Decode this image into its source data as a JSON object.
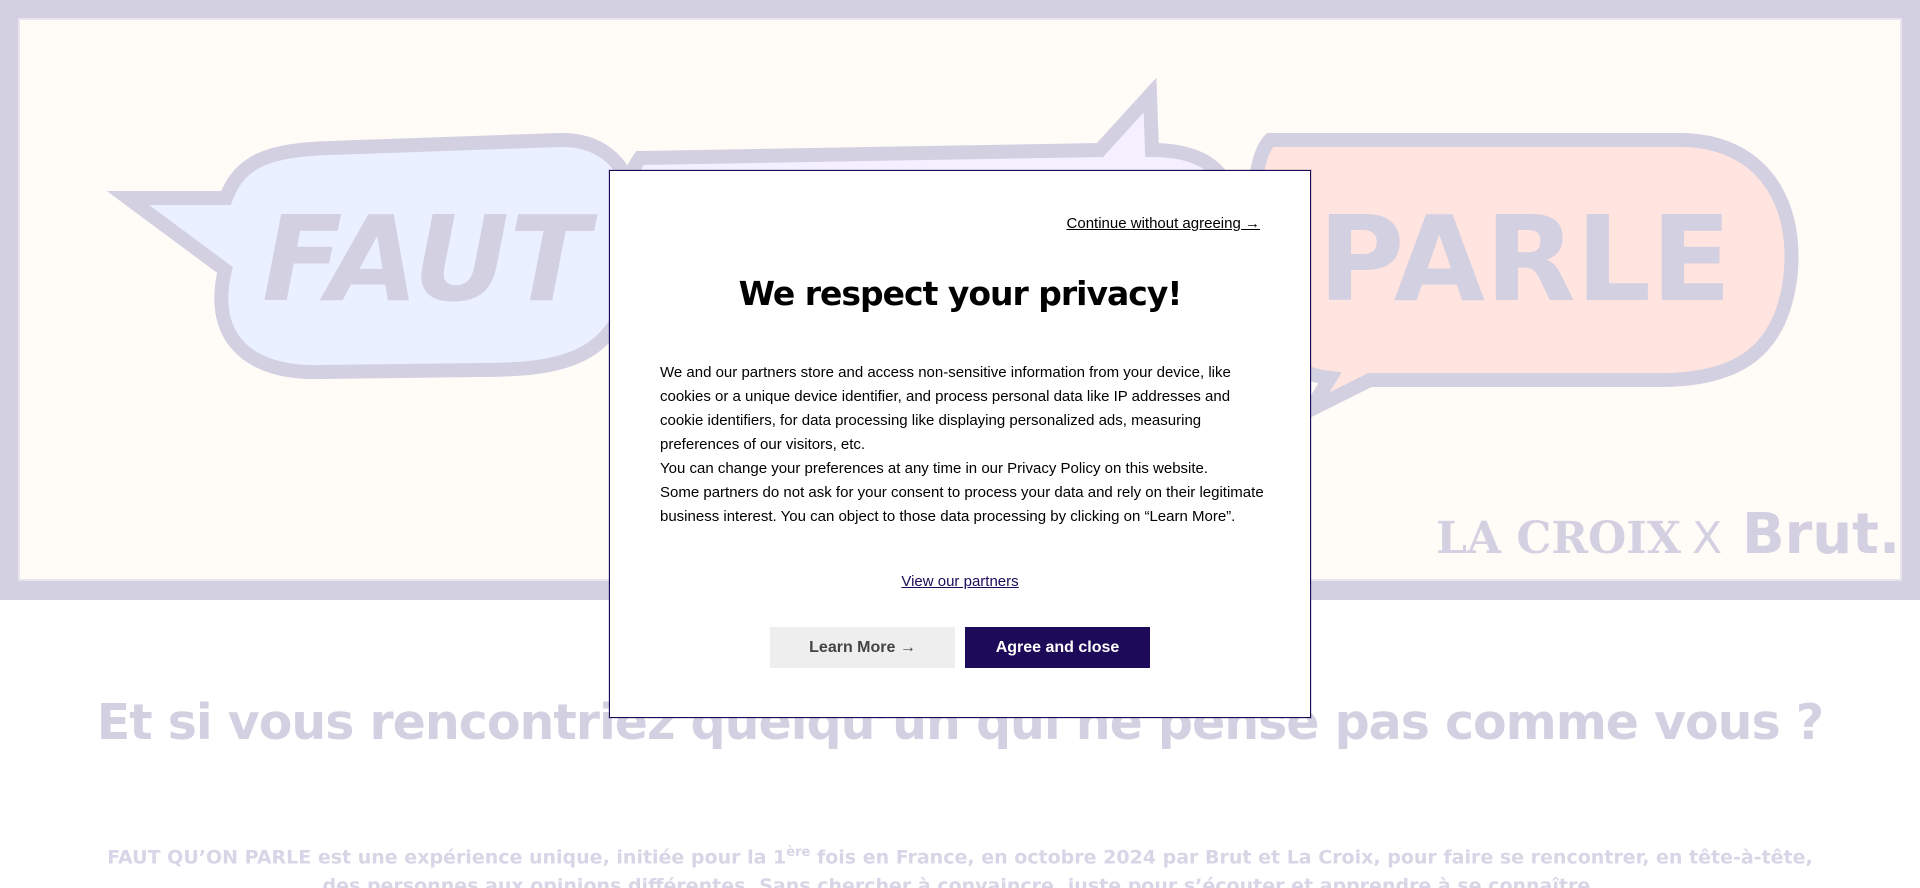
{
  "hero": {
    "word_left": "FAUT",
    "word_right": "PARLE",
    "brand_lacroix": "LA CROIX",
    "brand_x": "X",
    "brand_brut": "Brut."
  },
  "page": {
    "headline": "Et si vous rencontriez quelqu’un qui ne pense pas comme vous ?",
    "intro_part1": "FAUT QU’ON PARLE est une expérience unique, initiée pour la 1",
    "intro_sup": "ère",
    "intro_part2": " fois en France, en octobre 2024 par Brut et La Croix, pour faire se rencontrer, en tête-à-tête, des personnes aux opinions différentes. Sans chercher à convaincre, juste pour s’écouter et apprendre à se connaître."
  },
  "consent": {
    "skip_link": "Continue without agreeing →",
    "title": "We respect your privacy!",
    "paragraphs": [
      "We and our partners store and access non-sensitive information from your device, like cookies or a unique device identifier, and process personal data like IP addresses and cookie identifiers, for data processing like displaying personalized ads, measuring preferences of our visitors, etc.",
      "You can change your preferences at any time in our Privacy Policy on this website.",
      "Some partners do not ask for your consent to process your data and rely on their legitimate business interest. You can object to those data processing by clicking on “Learn More”."
    ],
    "partners_link": "View our partners",
    "learn_more_button": "Learn More →",
    "agree_button": "Agree and close"
  },
  "colors": {
    "primary": "#1d0b5a",
    "hero_bg": "#d3d0e2",
    "faded_text": "#d3d0e2"
  }
}
